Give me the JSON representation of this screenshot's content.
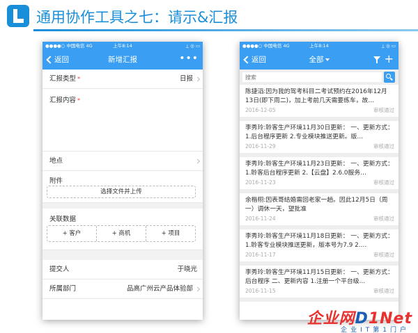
{
  "slide": {
    "title": "通用协作工具之七：请示&汇报"
  },
  "status_bar": {
    "carrier": "●●●●○ 中国电信  4G",
    "time": "上午8:14",
    "icons": "⟂ ◎ ▭"
  },
  "left_phone": {
    "nav": {
      "back_label": "返回",
      "title": "新增汇报",
      "more_label": "•••"
    },
    "rows": {
      "report_type_label": "汇报类型",
      "report_type_value": "日报",
      "report_content_label": "汇报内容",
      "location_label": "地点",
      "attachment_label": "附件",
      "upload_label": "选择文件并上传",
      "related_label": "关联数据",
      "add_customer": "+ 客户",
      "add_opportunity": "+ 商机",
      "add_project": "+ 项目",
      "submitter_label": "提交人",
      "submitter_value": "于晓光",
      "department_label": "所属部门",
      "department_value": "品高广州云产品体验部"
    },
    "required_mark": "*"
  },
  "right_phone": {
    "nav": {
      "back_label": "返回",
      "title": "全部"
    },
    "search": {
      "placeholder": "搜索"
    },
    "reports": [
      {
        "text": "陈捷滔:因为我的驾考科目二考试预约在2016年12月13日(即下周二)，加上考前几天需要练车，故…",
        "date": "2016-12-05",
        "status": "审核通过"
      },
      {
        "text": "李秀玲:聆客生产环境11月30日更新： 一、更新方式： 1.后台程序更新 2.专业模块推送更新。版…",
        "date": "2016-11-29",
        "status": "审核通过"
      },
      {
        "text": "李秀玲:聆客生产环境11月23日更新： 一、更新方式： 1.聆客后台程序更新 2.【云盘】2.6.0服务…",
        "date": "2016-11-23",
        "status": "审核通过"
      },
      {
        "text": "余楷栩:因表哥结婚需回老家一趟。因此12月5日（周一）调休一天，望批准",
        "date": "2016-11-24",
        "status": "审核通过"
      },
      {
        "text": "李秀玲:聆客生产环境11月18日更新： 一、更新方式： 1.聆客专业模块推送更新，版本号为7.9 2.…",
        "date": "2016-11-17",
        "status": "审核通过"
      },
      {
        "text": "李秀玲:聆客生产环境11月15日更新： 一、更新方式：后台程序 二、更新内容 1.注册一个平台级…",
        "date": "2016-11-15",
        "status": "审核通过"
      }
    ]
  },
  "watermark": {
    "brand_prefix": "企业网",
    "brand_d": "D",
    "brand_suffix": "1Net",
    "tagline": "企业IT第1门户"
  },
  "colors": {
    "accent": "#1a8fd9",
    "nav_blue": "#3a9ef2",
    "required_red": "#e33333",
    "watermark_red": "#e8322f"
  }
}
